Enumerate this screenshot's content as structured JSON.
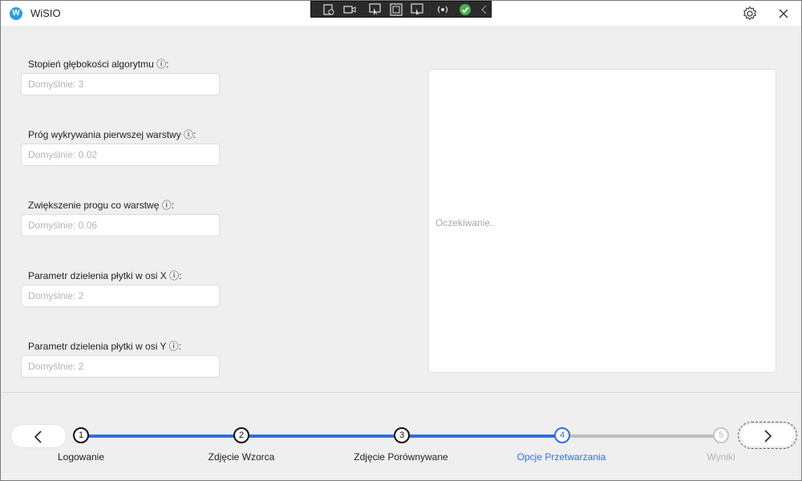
{
  "window": {
    "title": "WiSIO",
    "app_icon_letter": "W"
  },
  "recorder_toolbar": {
    "icons": [
      "screenshot-settings-icon",
      "video-icon",
      "select-window-icon",
      "select-region-icon",
      "fullscreen-capture-icon",
      "broadcast-icon",
      "check-icon",
      "collapse-chevron-icon"
    ]
  },
  "form": {
    "fields": [
      {
        "label": "Stopień głębokości algorytmu ⓘ:",
        "placeholder": "Domyślnie: 3"
      },
      {
        "label": "Próg wykrywania pierwszej warstwy ⓘ:",
        "placeholder": "Domyślnie: 0.02"
      },
      {
        "label": "Zwiększenie progu co warstwę ⓘ:",
        "placeholder": "Domyślnie: 0.06"
      },
      {
        "label": "Parametr dzielenia płytki w osi X ⓘ:",
        "placeholder": "Domyślnie: 2"
      },
      {
        "label": "Parametr dzielenia płytki w osi Y ⓘ:",
        "placeholder": "Domyślnie: 2"
      }
    ]
  },
  "preview": {
    "status": "Oczekiwanie.."
  },
  "stepper": {
    "steps": [
      {
        "number": "1",
        "label": "Logowanie",
        "state": "done"
      },
      {
        "number": "2",
        "label": "Zdjęcie Wzorca",
        "state": "done"
      },
      {
        "number": "3",
        "label": "Zdjęcie Porównywane",
        "state": "done"
      },
      {
        "number": "4",
        "label": "Opcje Przetwarzania",
        "state": "active"
      },
      {
        "number": "5",
        "label": "Wyniki",
        "state": "pending"
      }
    ]
  },
  "colors": {
    "accent": "#2f6fe0",
    "pending": "#bdbdbd",
    "done": "#111111"
  }
}
